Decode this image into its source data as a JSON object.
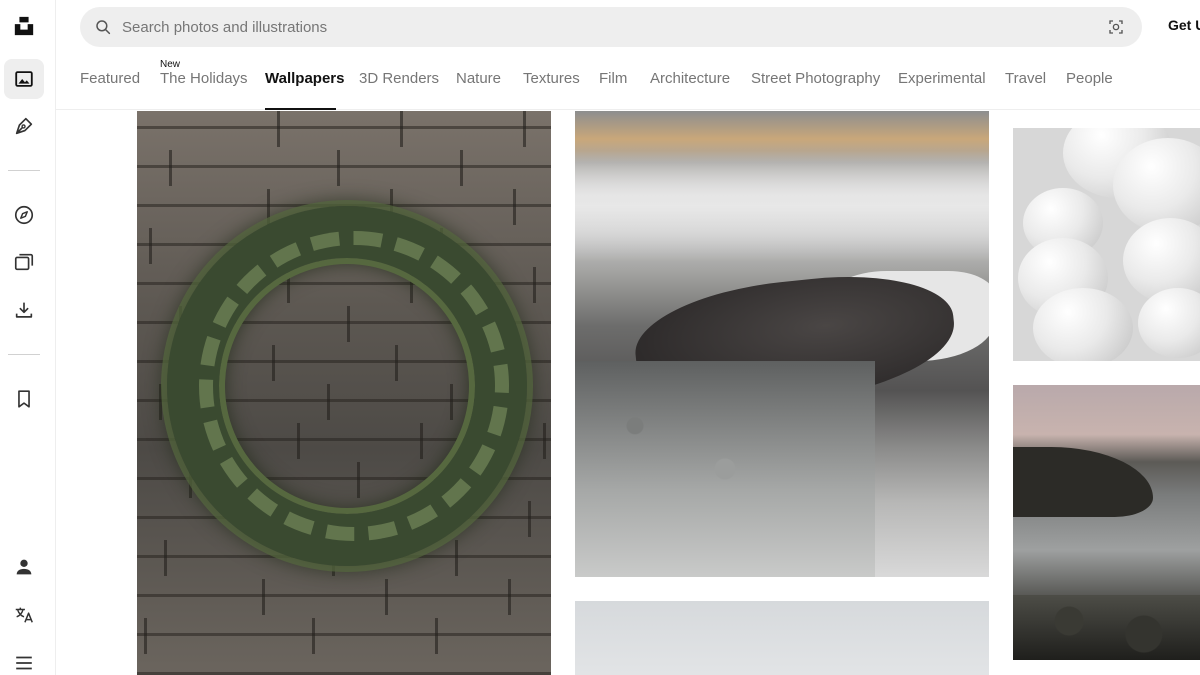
{
  "header": {
    "search_placeholder": "Search photos and illustrations",
    "get_button": "Get U"
  },
  "tabs": [
    {
      "label": "Featured",
      "badge": ""
    },
    {
      "label": "The Holidays",
      "badge": "New"
    },
    {
      "label": "Wallpapers",
      "badge": "",
      "active": true
    },
    {
      "label": "3D Renders",
      "badge": ""
    },
    {
      "label": "Nature",
      "badge": ""
    },
    {
      "label": "Textures",
      "badge": ""
    },
    {
      "label": "Film",
      "badge": ""
    },
    {
      "label": "Architecture",
      "badge": ""
    },
    {
      "label": "Street Photography",
      "badge": ""
    },
    {
      "label": "Experimental",
      "badge": ""
    },
    {
      "label": "Travel",
      "badge": ""
    },
    {
      "label": "People",
      "badge": ""
    }
  ],
  "sidebar": {
    "items": [
      {
        "icon": "unsplash-logo-icon"
      },
      {
        "icon": "photos-icon",
        "active": true
      },
      {
        "icon": "pen-nib-icon"
      },
      {
        "icon": "compass-icon"
      },
      {
        "icon": "collections-icon"
      },
      {
        "icon": "download-icon"
      },
      {
        "icon": "bookmark-icon"
      },
      {
        "icon": "user-icon"
      },
      {
        "icon": "translate-icon"
      },
      {
        "icon": "menu-icon"
      }
    ]
  },
  "colors": {
    "accent": "#111111",
    "muted_text": "#767676",
    "search_bg": "#eeeeee",
    "active_bg": "#eeeeee"
  }
}
